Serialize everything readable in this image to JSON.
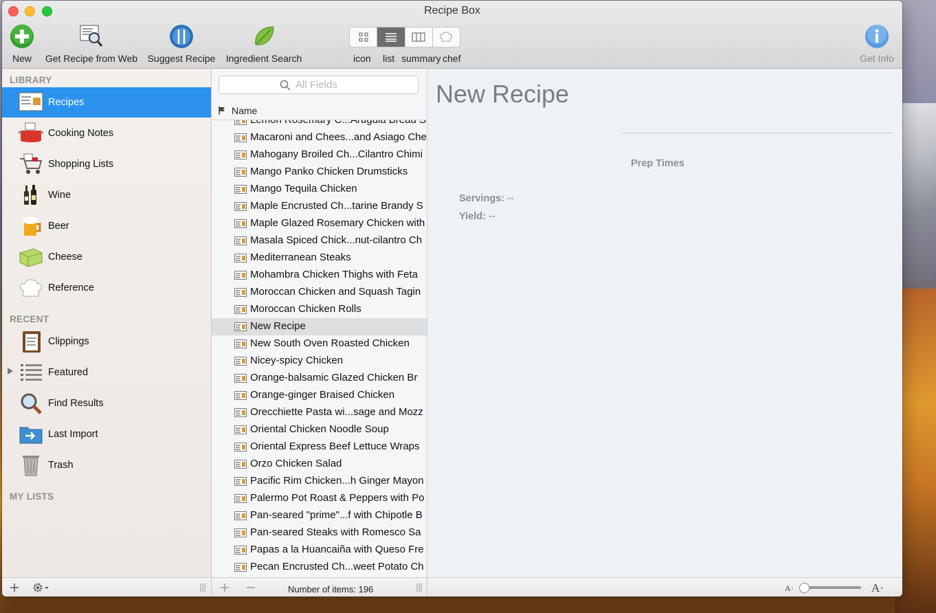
{
  "window": {
    "title": "Recipe Box"
  },
  "toolbar": {
    "new_label": "New",
    "get_web_label": "Get Recipe from Web",
    "suggest_label": "Suggest Recipe",
    "ingredient_label": "Ingredient Search",
    "view_icon_label": "icon",
    "view_list_label": "list",
    "view_summary_label": "summary",
    "view_chef_label": "chef",
    "get_info_label": "Get Info"
  },
  "sidebar": {
    "library_header": "LIBRARY",
    "recent_header": "RECENT",
    "mylists_header": "MY LISTS",
    "library_items": [
      {
        "label": "Recipes",
        "icon": "recipe-card-icon"
      },
      {
        "label": "Cooking Notes",
        "icon": "cooking-pot-icon"
      },
      {
        "label": "Shopping Lists",
        "icon": "shopping-cart-icon"
      },
      {
        "label": "Wine",
        "icon": "wine-bottles-icon"
      },
      {
        "label": "Beer",
        "icon": "beer-mug-icon"
      },
      {
        "label": "Cheese",
        "icon": "cheese-icon"
      },
      {
        "label": "Reference",
        "icon": "chef-hat-icon"
      }
    ],
    "recent_items": [
      {
        "label": "Clippings",
        "icon": "clipboard-icon"
      },
      {
        "label": "Featured",
        "icon": "list-icon"
      },
      {
        "label": "Find Results",
        "icon": "magnifier-icon"
      },
      {
        "label": "Last Import",
        "icon": "folder-import-icon"
      },
      {
        "label": "Trash",
        "icon": "trash-icon"
      }
    ]
  },
  "list": {
    "search_placeholder": "All Fields",
    "column_name": "Name",
    "items": [
      "Lemon Rosemary C...Arugula Bread S",
      "Macaroni and Chees...and Asiago Che",
      "Mahogany Broiled Ch...Cilantro Chimi",
      "Mango Panko Chicken Drumsticks",
      "Mango Tequila Chicken",
      "Maple Encrusted Ch...tarine Brandy S",
      "Maple Glazed Rosemary Chicken with",
      "Masala Spiced Chick...nut-cilantro Ch",
      "Mediterranean Steaks",
      "Mohambra Chicken Thighs with Feta",
      "Moroccan Chicken and Squash Tagin",
      "Moroccan Chicken Rolls",
      "New Recipe",
      "New South Oven Roasted Chicken",
      "Nicey-spicy Chicken",
      "Orange-balsamic Glazed Chicken Br",
      "Orange-ginger Braised Chicken",
      "Orecchiette Pasta wi...sage and Mozz",
      "Oriental Chicken Noodle Soup",
      "Oriental Express Beef Lettuce Wraps",
      "Orzo Chicken Salad",
      "Pacific Rim Chicken...h Ginger Mayon",
      "Palermo Pot Roast & Peppers with Po",
      "Pan-seared \"prime\"...f with Chipotle B",
      "Pan-seared Steaks with Romesco Sa",
      "Papas a la Huancaiña with Queso Fre",
      "Pecan Encrusted Ch...weet Potato Ch"
    ],
    "selected": "New Recipe",
    "count_text": "Number of items: 196"
  },
  "detail": {
    "title": "New Recipe",
    "prep_header": "Prep Times",
    "servings_label": "Servings:",
    "servings_value": "--",
    "yield_label": "Yield:",
    "yield_value": "--"
  },
  "colors": {
    "selection": "#2b93ee",
    "accent_green": "#3a9a2a",
    "accent_blue": "#2a6fb8"
  }
}
